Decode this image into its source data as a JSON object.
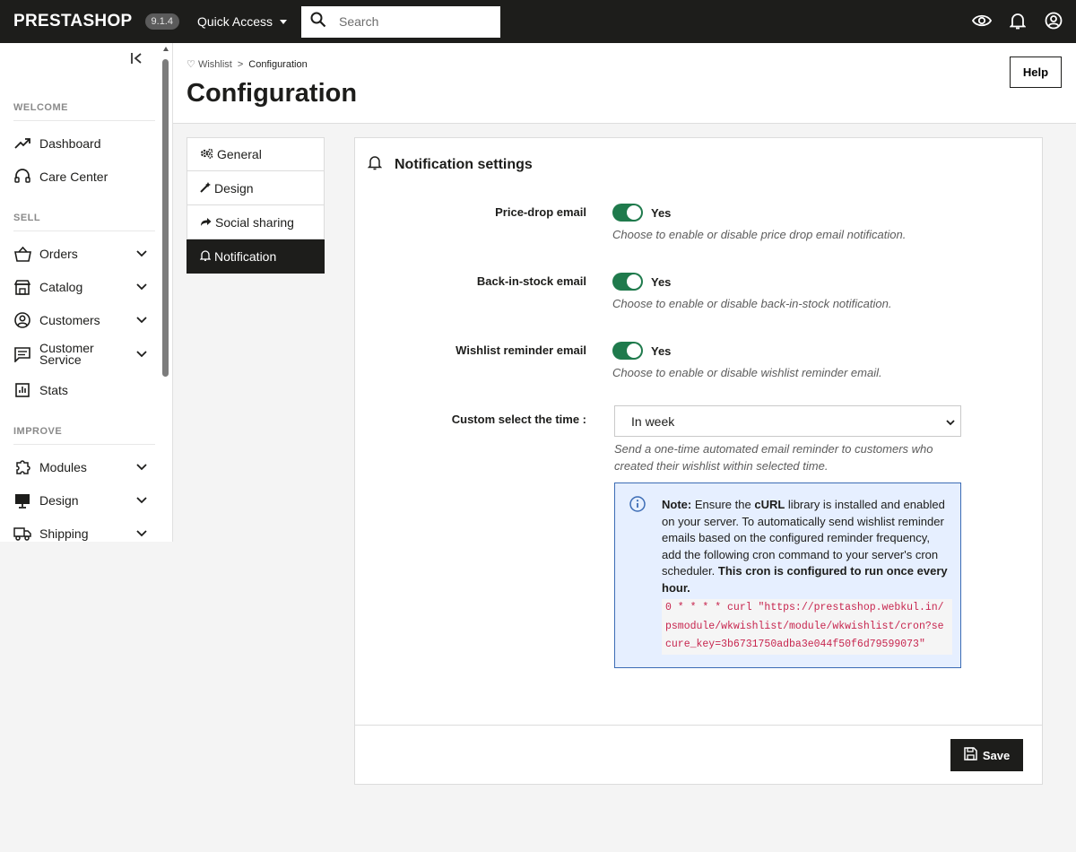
{
  "topbar": {
    "logo": "PRESTASHOP",
    "version": "9.1.4",
    "quick_access": "Quick Access",
    "search_placeholder": "Search"
  },
  "sidebar": {
    "sections": {
      "welcome": "WELCOME",
      "sell": "SELL",
      "improve": "IMPROVE"
    },
    "items": {
      "dashboard": "Dashboard",
      "care_center": "Care Center",
      "orders": "Orders",
      "catalog": "Catalog",
      "customers": "Customers",
      "customer_service_1": "Customer",
      "customer_service_2": "Service",
      "stats": "Stats",
      "modules": "Modules",
      "design": "Design",
      "shipping": "Shipping"
    }
  },
  "header": {
    "breadcrumb_parent": "Wishlist",
    "breadcrumb_separator": ">",
    "breadcrumb_current": "Configuration",
    "title": "Configuration",
    "help": "Help"
  },
  "tabs": {
    "general": "General",
    "design": "Design",
    "social": "Social sharing",
    "notification": "Notification"
  },
  "panel": {
    "heading": "Notification settings",
    "price_drop": {
      "label": "Price-drop email",
      "state": "Yes",
      "hint": "Choose to enable or disable price drop email notification."
    },
    "back_in_stock": {
      "label": "Back-in-stock email",
      "state": "Yes",
      "hint": "Choose to enable or disable back-in-stock notification."
    },
    "wishlist_reminder": {
      "label": "Wishlist reminder email",
      "state": "Yes",
      "hint": "Choose to enable or disable wishlist reminder email."
    },
    "custom_time": {
      "label": "Custom select the time :",
      "value": "In week",
      "hint_1": "Send a one-time automated email reminder to customers who",
      "hint_2": "created their wishlist within selected time."
    },
    "note": {
      "prefix": "Note:",
      "text_1": "Ensure the",
      "curl": "cURL",
      "text_2": "library is installed and enabled on your server. To automatically send wishlist reminder emails based on the configured reminder frequency, add the following cron command to your server's cron scheduler.",
      "bold_end": "This cron is configured to run once every hour.",
      "code": "0 * * * * curl \"https://prestashop.webkul.in/psmodule/wkwishlist/module/wkwishlist/cron?secure_key=3b6731750adba3e044f50f6d79599073\""
    },
    "save": "Save"
  },
  "colors": {
    "topbar": "#1d1d1b",
    "toggle_on": "#1f7a4c",
    "note_bg": "#e6efff",
    "note_border": "#3c6cb5",
    "code_text": "#c7254e"
  }
}
